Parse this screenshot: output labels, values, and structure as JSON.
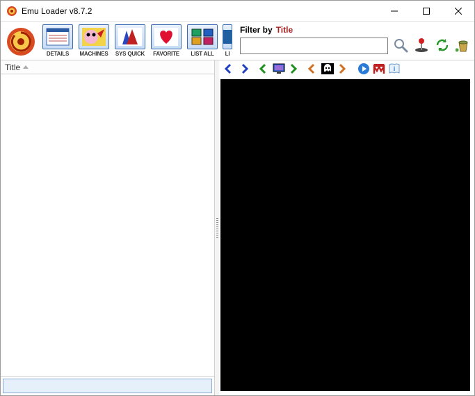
{
  "window": {
    "title": "Emu Loader v8.7.2"
  },
  "toolbar": {
    "buttons": [
      {
        "label": "DETAILS"
      },
      {
        "label": "MACHINES"
      },
      {
        "label": "SYS QUICK"
      },
      {
        "label": "FAVORITE"
      },
      {
        "label": "LIST ALL"
      },
      {
        "label": "LI"
      }
    ]
  },
  "filter": {
    "label": "Filter by",
    "title": "Title",
    "value": ""
  },
  "list": {
    "column": "Title"
  }
}
